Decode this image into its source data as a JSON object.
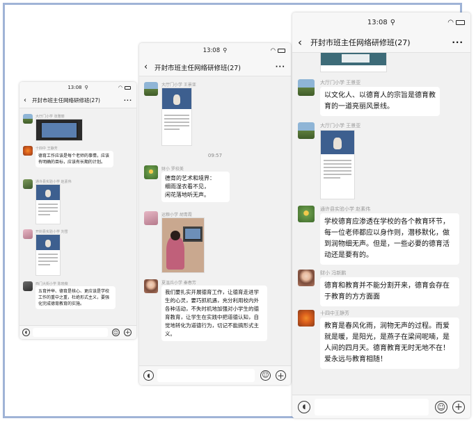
{
  "group_title": "开封市班主任网络研修班(27)",
  "phone1": {
    "status_time": "13:08",
    "messages": [
      {
        "sender": "大厅门小学 张雅丽"
      },
      {
        "sender": "十四中 王静芳",
        "text": "德育工作应该是每个老师的事情，应该有明确的目标，应该有长期的计划。"
      },
      {
        "sender": "通许县实验小学 赵素伟"
      },
      {
        "sender": "开封县实验小学 刘雪"
      },
      {
        "sender": "西门大街小学 陈晓薇",
        "text": "五育并举、德育是核心、更应该是学校工作的重中之重，杜绝形式主义，要强化完成德育教育的实施。"
      }
    ]
  },
  "phone2": {
    "status_time": "13:08",
    "timestamp": "09:57",
    "messages": [
      {
        "sender": "大厅门小学 王景亚"
      },
      {
        "sender": "财小 罗校美",
        "text": "德育的艺术和境界：\n细雨湿衣看不见，\n闲花落地听无声。"
      },
      {
        "sender": "运粮小学 胡青霞"
      },
      {
        "sender": "夏温兵小学 秦春芳",
        "text": "我们要扎实开展德育工作，让德育走进学生的心灵，要巧抓机遇，充分利用校内外各种活动，不失时机地加强对小学生的德育教育，让学生在实践中把道德认知，自觉地转化为道德行为，切记不能搞形式主义。"
      }
    ]
  },
  "phone3": {
    "status_time": "13:08",
    "messages": [
      {
        "sender": "大厅门小学 王景亚",
        "text": "以文化人、以德育人的宗旨是德育教育的一道亮丽风景线。"
      },
      {
        "sender": "大厅门小学 王景亚"
      },
      {
        "sender": "通许县实验小学 赵素伟",
        "text": "学校德育应渗透在学校的各个教育环节，每一位老师都应以身作则，潜移默化，做到润物细无声。但是，一些必要的德育活动还是要有的。"
      },
      {
        "sender": "财小 冯新鹏",
        "text": "德育和教育并不能分割开来，德育会存在于教育的方方面面"
      },
      {
        "sender": "十四中王静芳",
        "text": "教育是春风化雨，润物无声的过程。而爱就是暖，是阳光，是燕子在梁间呢喃，是人间的四月天。德育教育无时无地不在！爱永远与教育相随！"
      }
    ]
  }
}
